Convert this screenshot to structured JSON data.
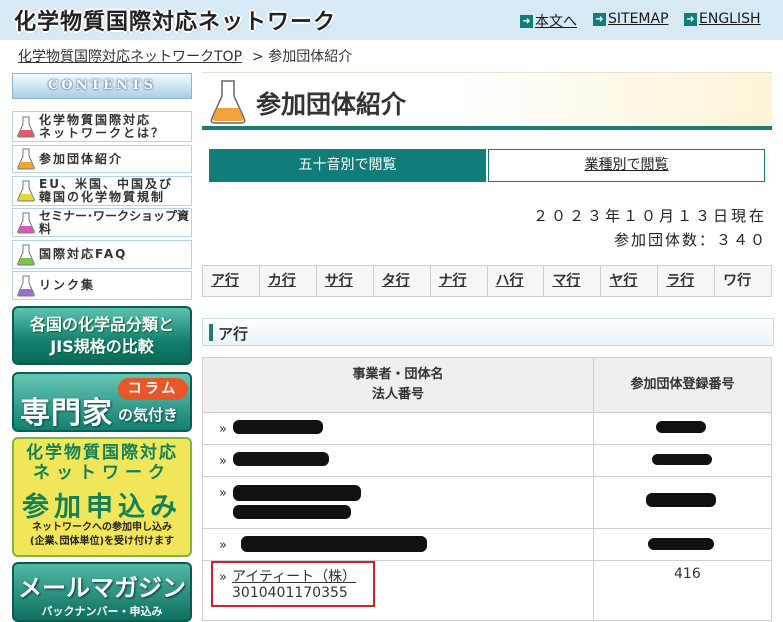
{
  "header": {
    "site_title": "化学物質国際対応ネットワーク",
    "nav": {
      "honbun": "本文へ",
      "sitemap": "SITEMAP",
      "english": "ENGLISH"
    }
  },
  "breadcrumb": {
    "home": "化学物質国際対応ネットワークTOP",
    "current": "> 参加団体紹介"
  },
  "sidebar": {
    "contents_label": "CONTENTS",
    "menu": {
      "about_line1": "化学物質国際対応",
      "about_line2": "ネットワークとは？",
      "members": "参加団体紹介",
      "regulations_line1": "EU、米国、中国及び",
      "regulations_line2": "韓国の化学物質規制",
      "seminar": "セミナー･ワークショップ資料",
      "faq": "国際対応FAQ",
      "links": "リンク集"
    },
    "banners": {
      "jis_line1": "各国の化学品分類と",
      "jis_line2": "JIS規格の比較",
      "expert_badge": "コラム",
      "expert_big": "専門家",
      "expert_small": "の気付き",
      "join_line1": "化学物質国際対応",
      "join_line2": "ネットワーク",
      "join_big": "参加申込み",
      "join_desc1": "ネットワークへの参加申し込み",
      "join_desc2": "(企業､団体単位)を受け付けます",
      "mail_big": "メールマガジン",
      "mail_small": "バックナンバー・申込み"
    }
  },
  "main": {
    "page_title": "参加団体紹介",
    "tabs": {
      "gojuon": "五十音別で閲覧",
      "industry": "業種別で閲覧"
    },
    "date_line": "２０２３年１０月１３日現在",
    "count_line": "参加団体数：３４０",
    "row_nav": [
      "ア行",
      "カ行",
      "サ行",
      "タ行",
      "ナ行",
      "ハ行",
      "マ行",
      "ヤ行",
      "ラ行",
      "ワ行"
    ],
    "section_heading": "ア行",
    "table": {
      "header_name_line1": "事業者・団体名",
      "header_name_line2": "法人番号",
      "header_reg": "参加団体登録番号",
      "visible_row": {
        "marker": "»",
        "name": "アイティート（株）",
        "corporate_number": "3010401170355",
        "registration_number": "416"
      },
      "row_marker": "»"
    }
  },
  "colors": {
    "accent_teal": "#117d7a",
    "header_bg": "#d7e9f5",
    "highlight_red": "#d3202a"
  }
}
